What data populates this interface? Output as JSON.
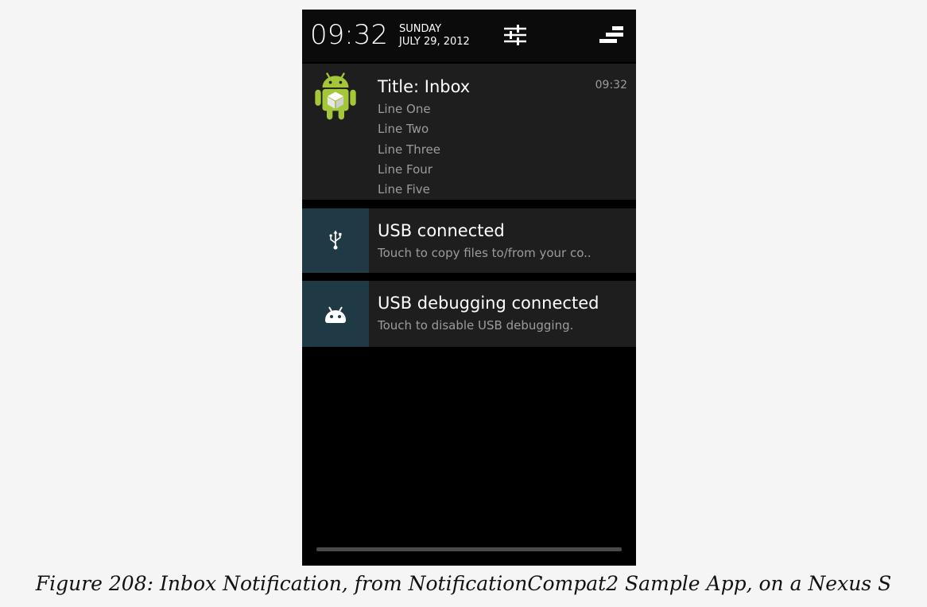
{
  "status_bar": {
    "clock": "09:32",
    "day": "SUNDAY",
    "date": "JULY 29, 2012",
    "settings_icon": "quick-settings-sliders-icon",
    "clear_icon": "clear-all-notifications-icon"
  },
  "notifications": [
    {
      "icon": "android-robot-icon",
      "title": "Title: Inbox",
      "time": "09:32",
      "lines": [
        "Line One",
        "Line Two",
        "Line Three",
        "Line Four",
        "Line Five"
      ]
    },
    {
      "icon": "usb-icon",
      "title": "USB connected",
      "text": "Touch to copy files to/from your co.."
    },
    {
      "icon": "android-debug-icon",
      "title": "USB debugging connected",
      "text": "Touch to disable USB debugging."
    }
  ],
  "caption": "Figure 208: Inbox Notification, from NotificationCompat2 Sample App, on a Nexus S",
  "colors": {
    "icon_background": "#1f3a44",
    "notification_background": "#1e1e1e",
    "secondary_text": "#9c9c9c",
    "android_green": "#a4c639"
  }
}
